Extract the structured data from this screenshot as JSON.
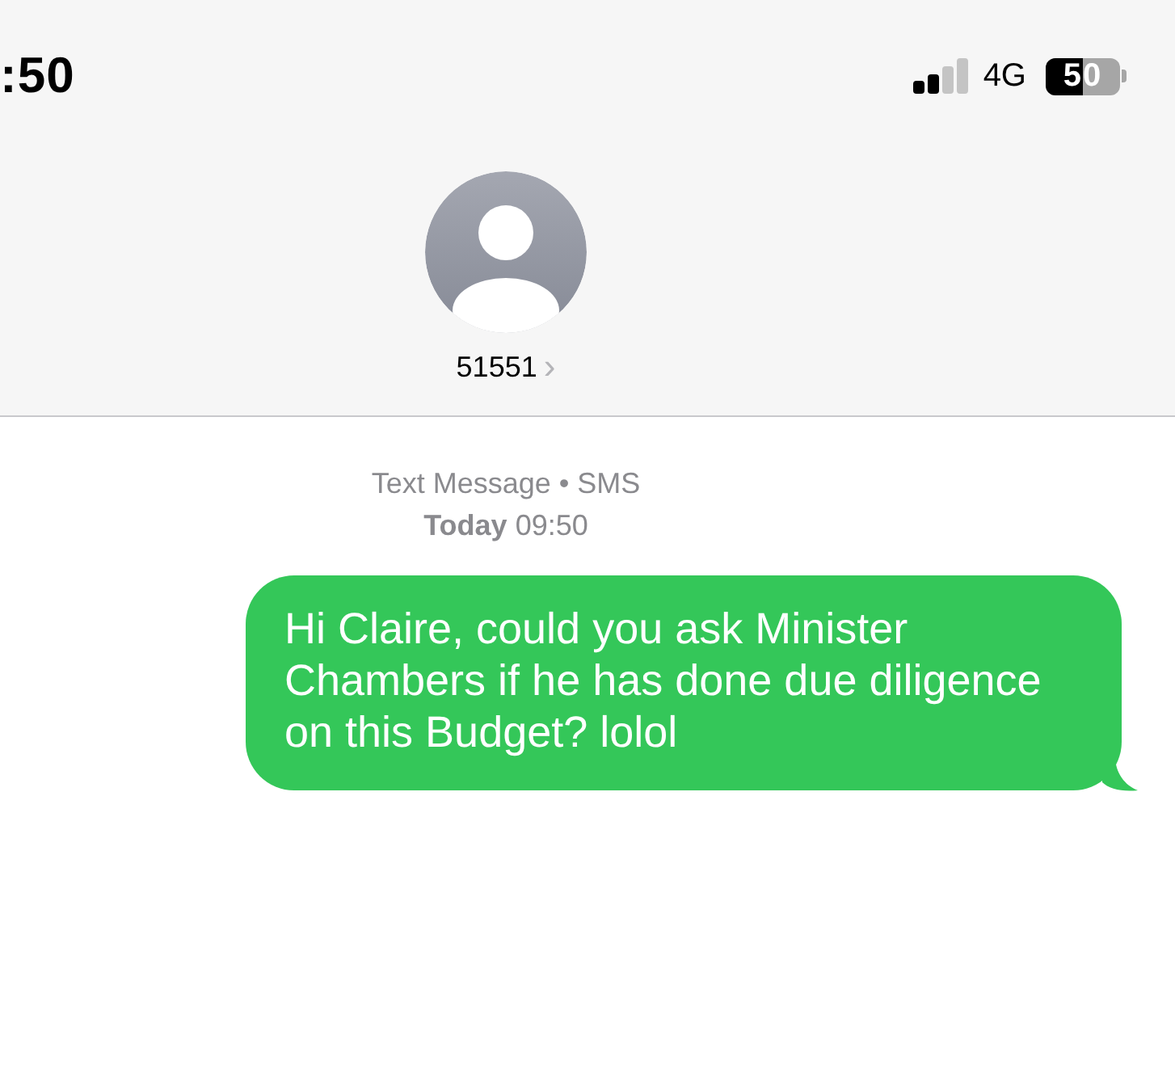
{
  "status_bar": {
    "time": ":50",
    "network": "4G",
    "battery": "50"
  },
  "contact": {
    "name": "51551",
    "chevron": "›"
  },
  "thread": {
    "service": "Text Message • SMS",
    "timestamp_label": "Today",
    "timestamp": "09:50",
    "messages": [
      {
        "kind": "sent",
        "text": "Hi Claire, could you ask Minister Chambers if he has done due diligence on this Budget? lolol"
      }
    ]
  }
}
